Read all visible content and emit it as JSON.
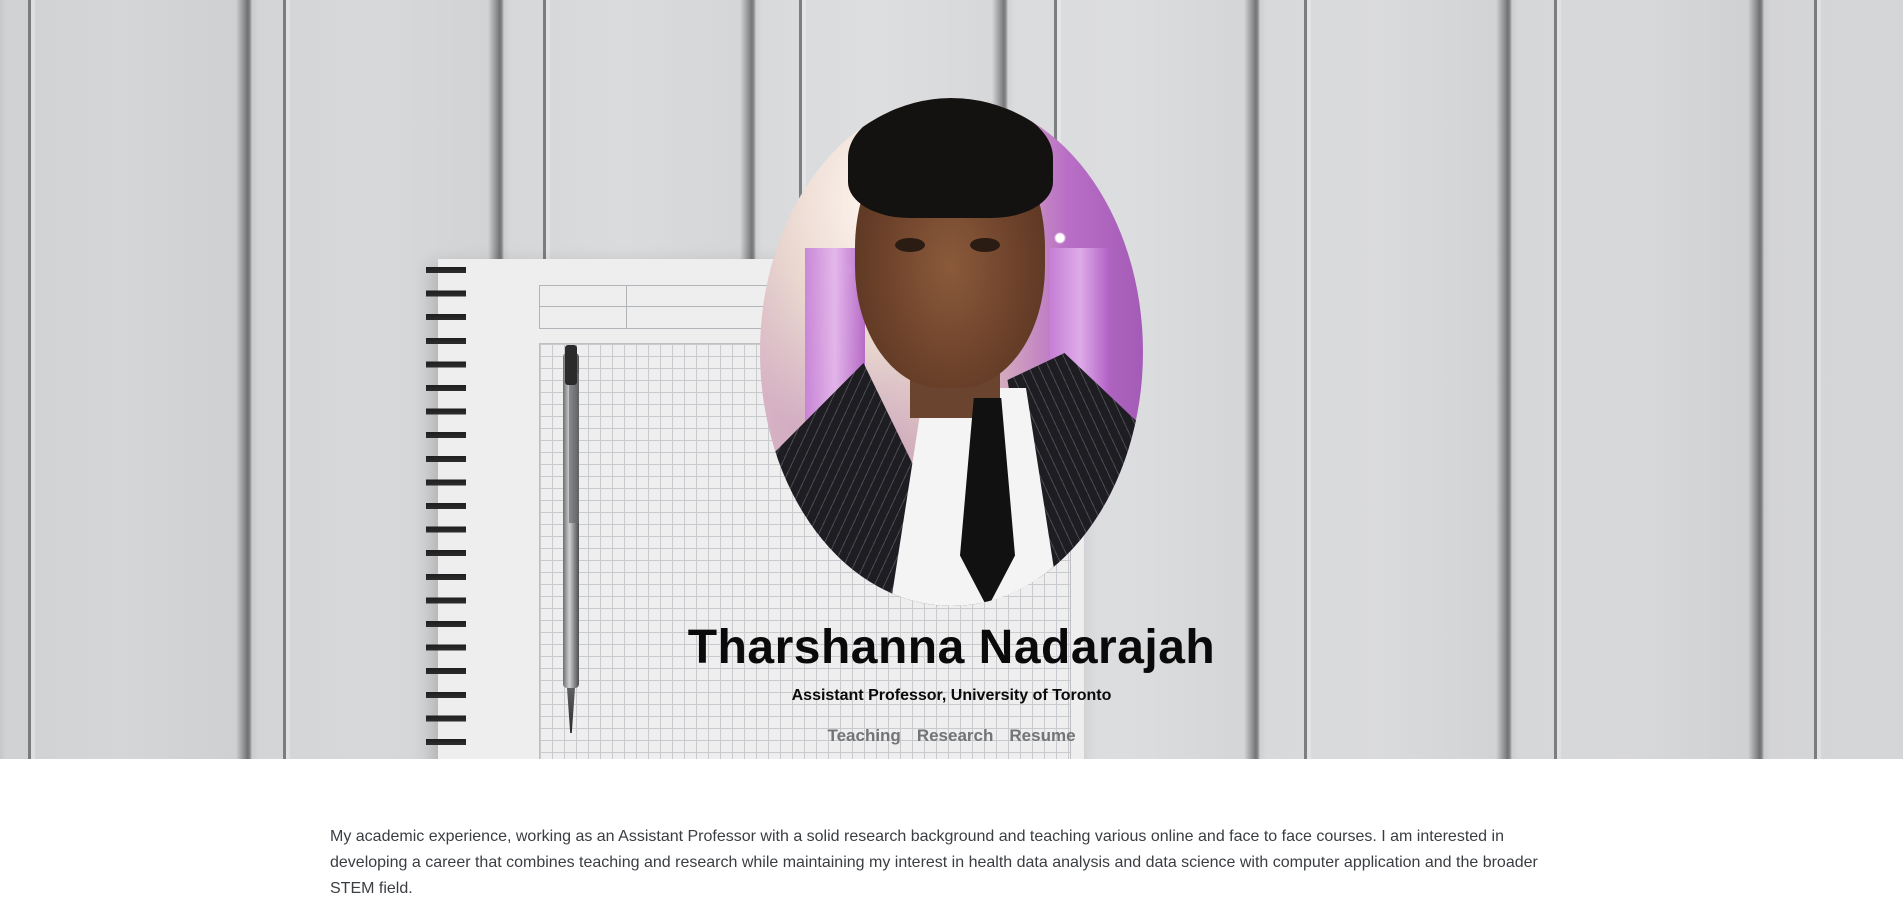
{
  "hero": {
    "name": "Tharshanna Nadarajah",
    "subtitle": "Assistant Professor, University of Toronto",
    "nav": [
      {
        "label": "Teaching"
      },
      {
        "label": "Research"
      },
      {
        "label": "Resume"
      }
    ],
    "background_image": "notebook-and-pen-on-wood-planks",
    "avatar_image": "profile-photo"
  },
  "about": {
    "text": "My academic experience, working as an Assistant Professor with a solid research background and teaching various online and face to face courses. I am interested in developing a career that combines teaching and research while maintaining my interest in health data analysis and data science with computer application and the broader STEM field."
  },
  "colors": {
    "nav_link": "#727476",
    "heading": "#0a0a0a",
    "body_text": "#3a3d42"
  }
}
